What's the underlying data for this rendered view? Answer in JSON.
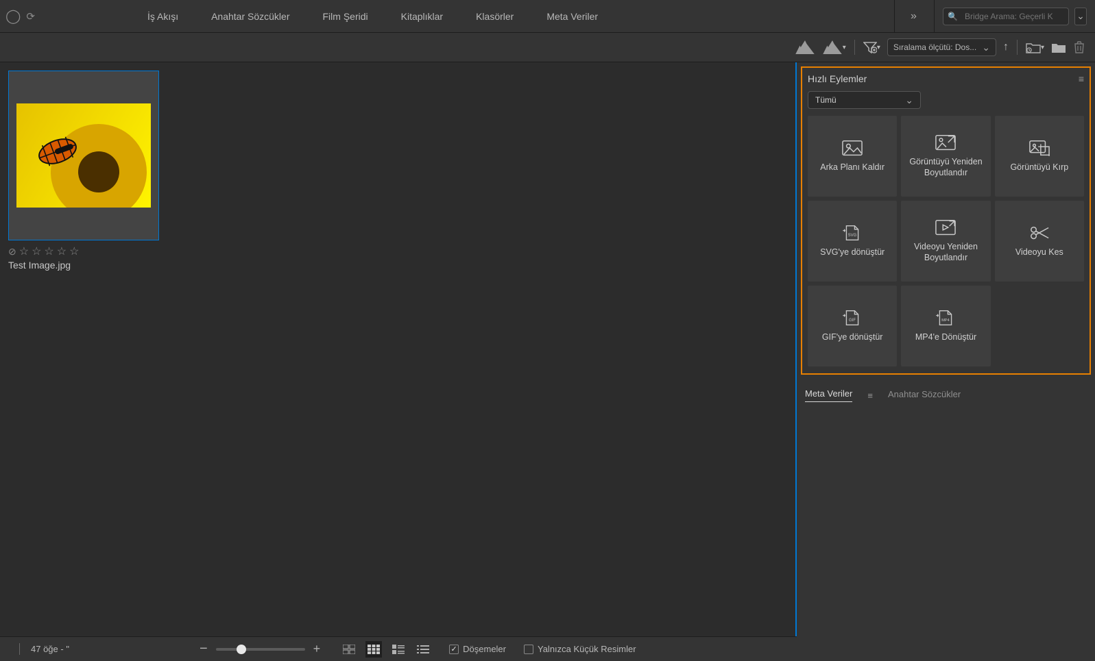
{
  "topbar": {
    "workspaces": [
      "İş Akışı",
      "Anahtar Sözcükler",
      "Film Şeridi",
      "Kitaplıklar",
      "Klasörler",
      "Meta Veriler"
    ],
    "search_placeholder": "Bridge Arama: Geçerli K"
  },
  "controlbar": {
    "sort_label": "Sıralama ölçütü: Dos..."
  },
  "content": {
    "thumb_filename": "Test Image.jpg"
  },
  "quick_actions": {
    "title": "Hızlı Eylemler",
    "filter_label": "Tümü",
    "cards": [
      {
        "label": "Arka Planı Kaldır",
        "icon": "image-remove-bg"
      },
      {
        "label": "Görüntüyü Yeniden Boyutlandır",
        "icon": "image-resize"
      },
      {
        "label": "Görüntüyü Kırp",
        "icon": "image-crop"
      },
      {
        "label": "SVG'ye dönüştür",
        "icon": "convert-svg"
      },
      {
        "label": "Videoyu Yeniden Boyutlandır",
        "icon": "video-resize"
      },
      {
        "label": "Videoyu Kes",
        "icon": "video-cut"
      },
      {
        "label": "GIF'ye dönüştür",
        "icon": "convert-gif"
      },
      {
        "label": "MP4'e Dönüştür",
        "icon": "convert-mp4"
      }
    ]
  },
  "side_tabs": {
    "metadata": "Meta Veriler",
    "keywords": "Anahtar Sözcükler"
  },
  "bottombar": {
    "status": "47 öğe - \"",
    "check_tiles_label": "Döşemeler",
    "check_thumbs_label": "Yalnızca Küçük Resimler",
    "tiles_checked": true,
    "thumbs_checked": false
  },
  "colors": {
    "accent_blue": "#0078d4",
    "accent_orange": "#e88000"
  }
}
